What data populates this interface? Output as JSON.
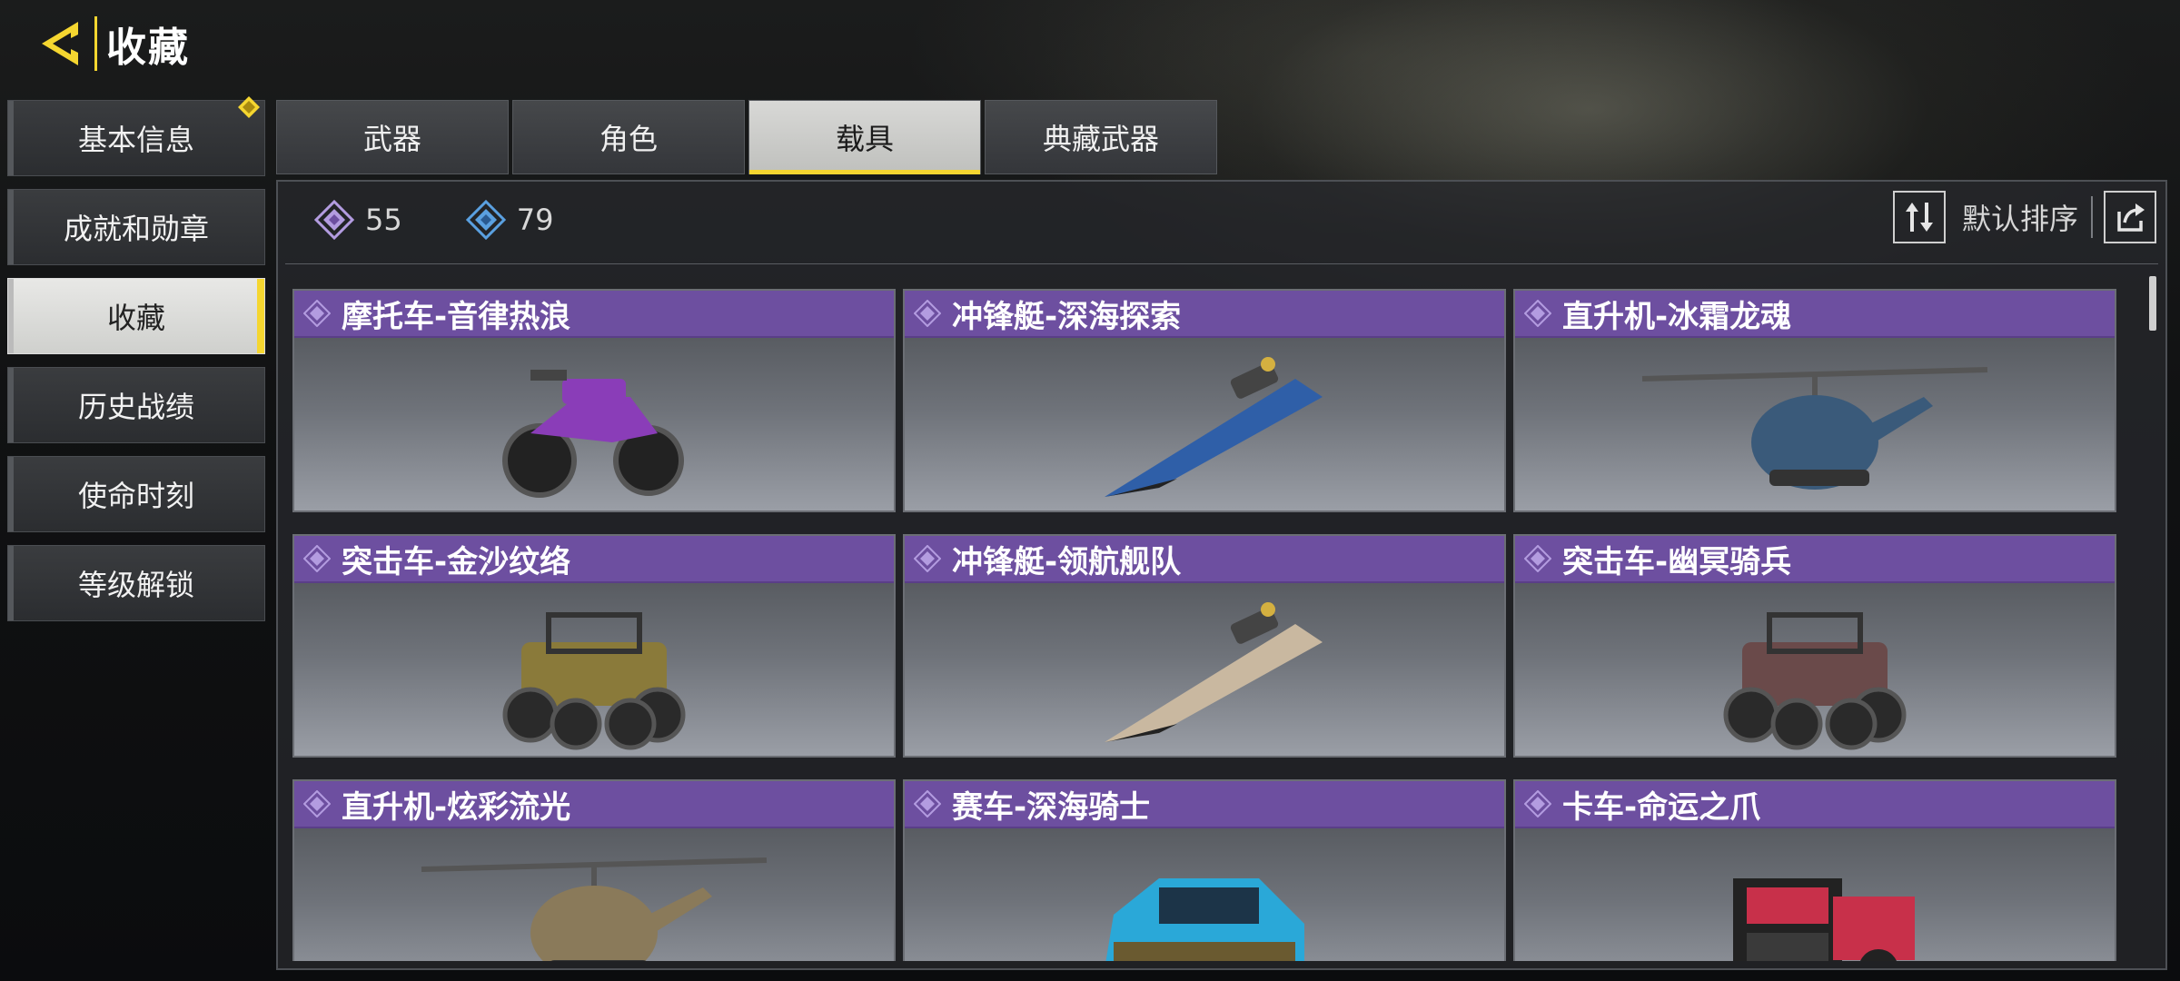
{
  "header": {
    "title": "收藏"
  },
  "nav": {
    "items": [
      {
        "label": "基本信息"
      },
      {
        "label": "成就和勋章"
      },
      {
        "label": "收藏"
      },
      {
        "label": "历史战绩"
      },
      {
        "label": "使命时刻"
      },
      {
        "label": "等级解锁"
      }
    ]
  },
  "tabs": [
    {
      "label": "武器"
    },
    {
      "label": "角色"
    },
    {
      "label": "载具"
    },
    {
      "label": "典藏武器"
    }
  ],
  "counts": {
    "epic": "55",
    "rare": "79"
  },
  "sort": {
    "label": "默认排序"
  },
  "items": [
    {
      "name": "摩托车-音律热浪",
      "icon": "motorcycle",
      "color": "#8a3db8"
    },
    {
      "name": "冲锋艇-深海探索",
      "icon": "speedboat",
      "color": "#2f5fa8"
    },
    {
      "name": "直升机-冰霜龙魂",
      "icon": "helicopter",
      "color": "#3a5a7a"
    },
    {
      "name": "突击车-金沙纹络",
      "icon": "buggy",
      "color": "#8a7a3a"
    },
    {
      "name": "冲锋艇-领航舰队",
      "icon": "speedboat",
      "color": "#c9b8a0"
    },
    {
      "name": "突击车-幽冥骑兵",
      "icon": "buggy",
      "color": "#6a4a4a"
    },
    {
      "name": "直升机-炫彩流光",
      "icon": "helicopter",
      "color": "#8a7a5a"
    },
    {
      "name": "赛车-深海骑士",
      "icon": "racecar",
      "color": "#2aa8d8"
    },
    {
      "name": "卡车-命运之爪",
      "icon": "truck",
      "color": "#c8304a"
    }
  ],
  "colors": {
    "accent": "#f5d630",
    "epic": "#6d4fa0",
    "epic_diamond": "#b39ce0",
    "rare_diamond": "#5aa0e0"
  }
}
